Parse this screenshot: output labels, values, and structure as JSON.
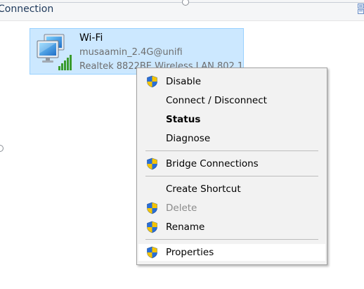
{
  "header": {
    "title": "Connection",
    "icon": "view-options-icon"
  },
  "connection": {
    "name": "Wi-Fi",
    "network": "musaamin_2.4G@unifi",
    "adapter": "Realtek 8822BE Wireless LAN 802.11ac PCI-E NIC",
    "icon": "wifi-adapter-icon",
    "selected": true
  },
  "context_menu": {
    "items": [
      {
        "label": "Disable",
        "icon": "uac-shield-icon",
        "bold": false,
        "enabled": true
      },
      {
        "label": "Connect / Disconnect",
        "icon": "",
        "bold": false,
        "enabled": true
      },
      {
        "label": "Status",
        "icon": "",
        "bold": true,
        "enabled": true
      },
      {
        "label": "Diagnose",
        "icon": "",
        "bold": false,
        "enabled": true
      },
      {
        "label": "Bridge Connections",
        "icon": "uac-shield-icon",
        "bold": false,
        "enabled": true
      },
      {
        "label": "Create Shortcut",
        "icon": "",
        "bold": false,
        "enabled": true
      },
      {
        "label": "Delete",
        "icon": "uac-shield-icon",
        "bold": false,
        "enabled": false
      },
      {
        "label": "Rename",
        "icon": "uac-shield-icon",
        "bold": false,
        "enabled": true
      },
      {
        "label": "Properties",
        "icon": "uac-shield-icon",
        "bold": false,
        "enabled": true,
        "hovered": true
      }
    ]
  },
  "colors": {
    "selection_bg": "#cce8ff",
    "selection_border": "#99d1ff",
    "menu_bg": "#f2f2f2",
    "menu_hover": "#ffffff",
    "disabled_text": "#8b8b8b",
    "shield_blue": "#2a6fd6",
    "shield_yellow": "#f5c400"
  }
}
